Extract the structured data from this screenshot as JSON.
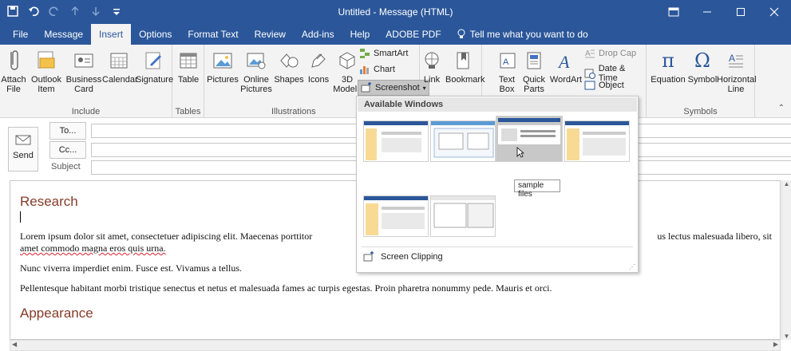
{
  "window": {
    "title": "Untitled  -  Message (HTML)",
    "controls": [
      "ribbon-display",
      "minimize",
      "maximize",
      "close"
    ]
  },
  "tabs": [
    {
      "label": "File"
    },
    {
      "label": "Message"
    },
    {
      "label": "Insert",
      "active": true
    },
    {
      "label": "Options"
    },
    {
      "label": "Format Text"
    },
    {
      "label": "Review"
    },
    {
      "label": "Add-ins"
    },
    {
      "label": "Help"
    },
    {
      "label": "ADOBE PDF"
    }
  ],
  "tell_me": "Tell me what you want to do",
  "ribbon": {
    "include": {
      "label": "Include",
      "attach": [
        "Attach",
        "File"
      ],
      "outlook_item": [
        "Outlook",
        "Item"
      ],
      "business_card": [
        "Business",
        "Card"
      ],
      "calendar": "Calendar",
      "signature": "Signature"
    },
    "tables": {
      "label": "Tables",
      "table": "Table"
    },
    "illustrations": {
      "label": "Illustrations",
      "pictures": "Pictures",
      "online_pictures": [
        "Online",
        "Pictures"
      ],
      "shapes": "Shapes",
      "icons": "Icons",
      "models": [
        "3D",
        "Models"
      ],
      "smartart": "SmartArt",
      "chart": "Chart",
      "screenshot": "Screenshot"
    },
    "links": {
      "link": "Link",
      "bookmark": "Bookmark"
    },
    "text": {
      "text_box": [
        "Text",
        "Box"
      ],
      "quick_parts": [
        "Quick",
        "Parts"
      ],
      "wordart": "WordArt",
      "drop_cap": "Drop Cap",
      "date_time": "Date & Time",
      "object": "Object"
    },
    "symbols": {
      "label": "Symbols",
      "equation": "Equation",
      "symbol": "Symbol",
      "horizontal_line": [
        "Horizontal",
        "Line"
      ]
    }
  },
  "compose": {
    "send": "Send",
    "to": "To...",
    "cc": "Cc...",
    "subject": "Subject"
  },
  "screenshot_menu": {
    "header": "Available Windows",
    "tooltip": "sample files",
    "screen_clipping": "Screen Clipping"
  },
  "body": {
    "heading1": "Research",
    "para1": "Lorem ipsum dolor sit amet, consectetuer adipiscing elit. Maecenas porttitor",
    "para1_right": "us lectus malesuada libero, sit",
    "para1_line2": "amet commodo magna eros quis urna.",
    "para2": "Nunc viverra imperdiet enim. Fusce est. Vivamus a tellus.",
    "para3": "Pellentesque habitant morbi tristique senectus et netus et malesuada fames ac turpis egestas. Proin pharetra nonummy pede. Mauris et orci.",
    "heading2": "Appearance"
  }
}
